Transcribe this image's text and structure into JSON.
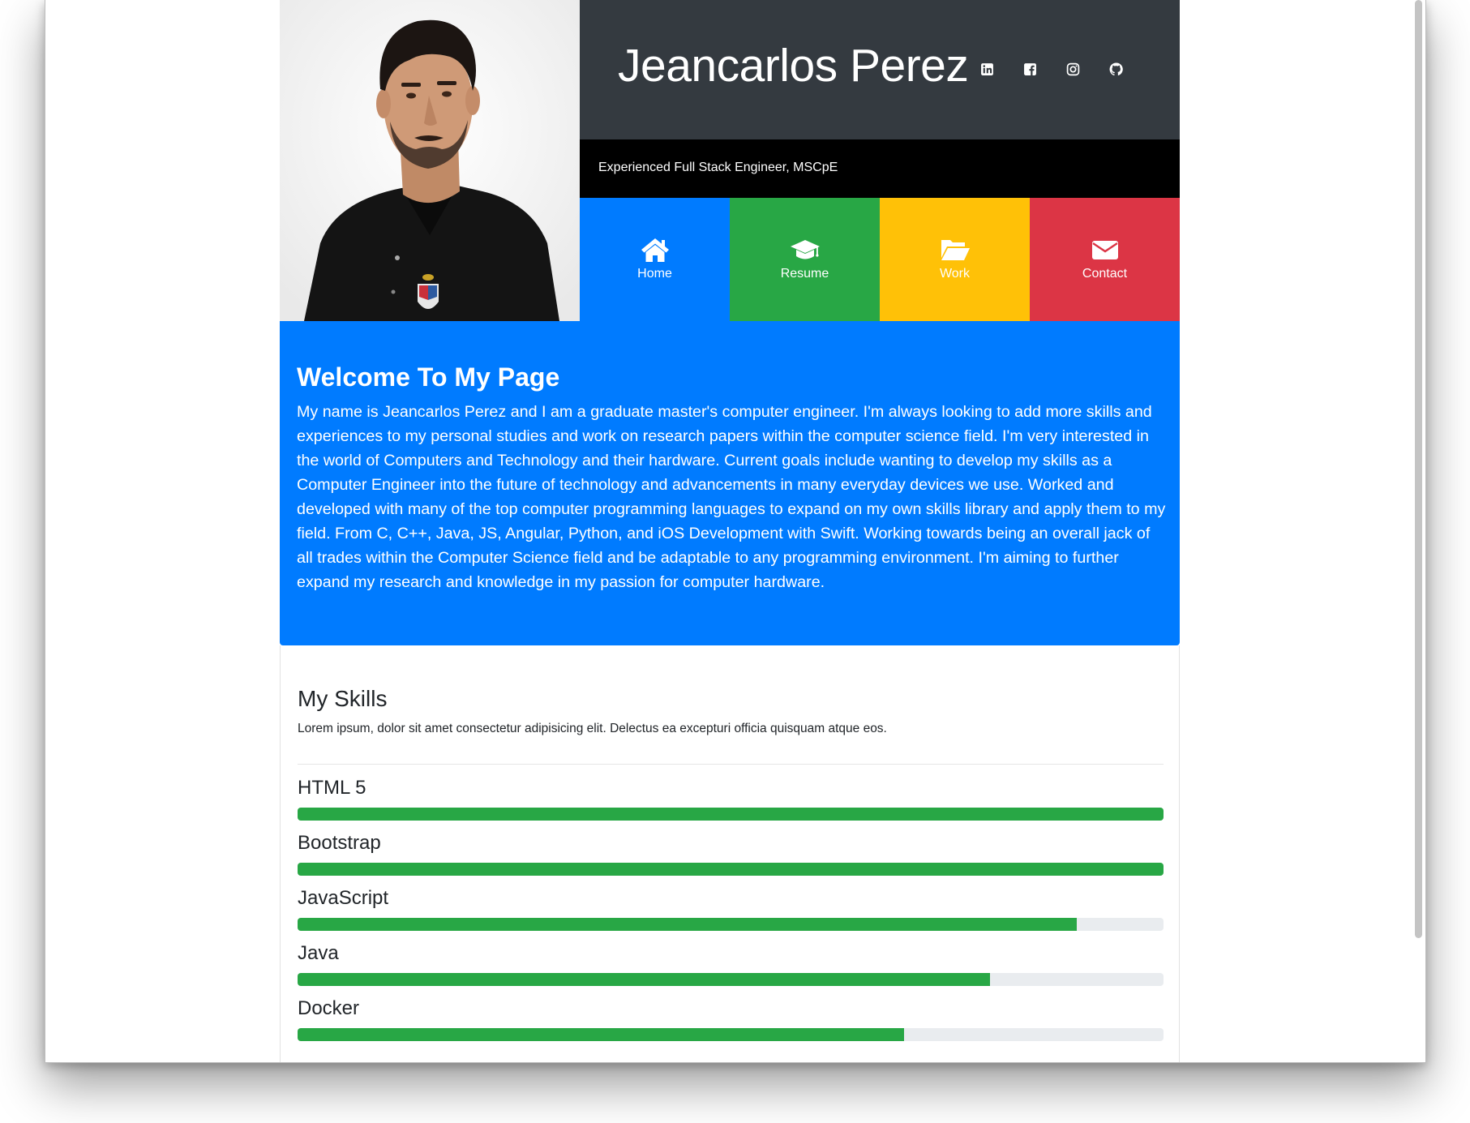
{
  "header": {
    "name": "Jeancarlos Perez",
    "tagline": "Experienced Full Stack Engineer, MSCpE",
    "social_icons": [
      "linkedin-icon",
      "facebook-icon",
      "instagram-icon",
      "github-icon"
    ]
  },
  "nav": {
    "tiles": [
      {
        "label": "Home",
        "icon": "home-icon",
        "color": "#007bff"
      },
      {
        "label": "Resume",
        "icon": "graduation-cap-icon",
        "color": "#28a745"
      },
      {
        "label": "Work",
        "icon": "folder-open-icon",
        "color": "#ffc107"
      },
      {
        "label": "Contact",
        "icon": "envelope-icon",
        "color": "#dc3545"
      }
    ]
  },
  "welcome": {
    "title": "Welcome To My Page",
    "body": "My name is Jeancarlos Perez and I am a graduate master's computer engineer. I'm always looking to add more skills and experiences to my personal studies and work on research papers within the computer science field. I'm very interested in the world of Computers and Technology and their hardware. Current goals include wanting to develop my skills as a Computer Engineer into the future of technology and advancements in many everyday devices we use. Worked and developed with many of the top computer programming languages to expand on my own skills library and apply them to my field. From C, C++, Java, JS, Angular, Python, and iOS Development with Swift. Working towards being an overall jack of all trades within the Computer Science field and be adaptable to any programming environment. I'm aiming to further expand my research and knowledge in my passion for computer hardware."
  },
  "skills": {
    "title": "My Skills",
    "intro": "Lorem ipsum, dolor sit amet consectetur adipisicing elit. Delectus ea excepturi officia quisquam atque eos.",
    "items": [
      {
        "name": "HTML 5",
        "percent": 100
      },
      {
        "name": "Bootstrap",
        "percent": 100
      },
      {
        "name": "JavaScript",
        "percent": 90
      },
      {
        "name": "Java",
        "percent": 80
      },
      {
        "name": "Docker",
        "percent": 70
      }
    ],
    "bar_color": "#28a745"
  }
}
